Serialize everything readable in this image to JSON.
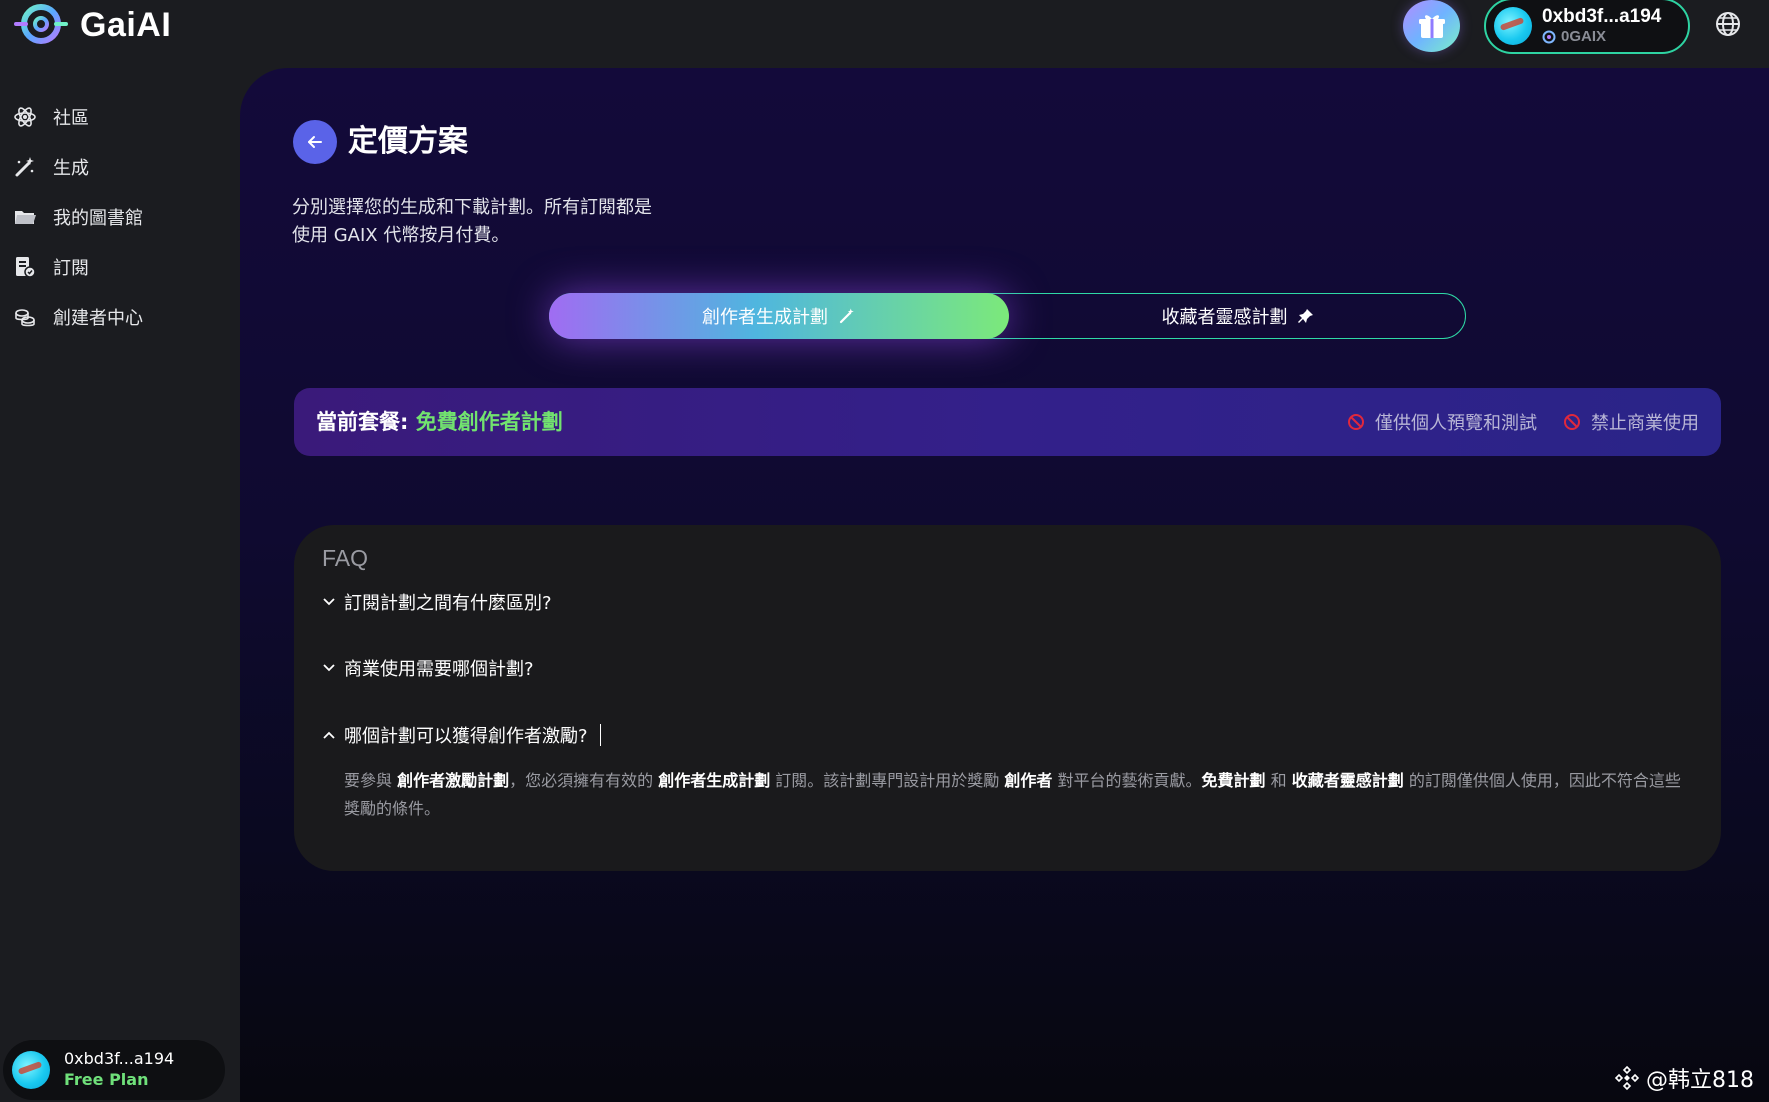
{
  "app": {
    "name": "GaiAI"
  },
  "header": {
    "wallet_address": "0xbd3f...a194",
    "wallet_token": "0GAIX"
  },
  "sidebar": {
    "items": [
      {
        "label": "社區",
        "icon": "atom-icon"
      },
      {
        "label": "生成",
        "icon": "magic-wand-icon"
      },
      {
        "label": "我的圖書館",
        "icon": "folder-icon"
      },
      {
        "label": "訂閱",
        "icon": "subscription-icon"
      },
      {
        "label": "創建者中心",
        "icon": "coins-icon"
      }
    ],
    "user": {
      "address": "0xbd3f...a194",
      "plan": "Free Plan"
    }
  },
  "main": {
    "title": "定價方案",
    "subtitle_line1": "分別選擇您的生成和下載計劃。所有訂閱都是",
    "subtitle_line2": "使用 GAIX 代幣按月付費。",
    "toggle": {
      "active_label": "創作者生成計劃",
      "inactive_label": "收藏者靈感計劃"
    },
    "current_plan": {
      "prefix": "當前套餐",
      "separator": ":",
      "name": "免費創作者計劃",
      "restrictions": [
        "僅供個人預覽和測試",
        "禁止商業使用"
      ]
    },
    "faq": {
      "title": "FAQ",
      "questions": [
        {
          "q": "訂閱計劃之間有什麼區別?",
          "expanded": false
        },
        {
          "q": "商業使用需要哪個計劃?",
          "expanded": false
        },
        {
          "q": "哪個計劃可以獲得創作者激勵?",
          "expanded": true
        }
      ],
      "answer": {
        "t1": "要參與 ",
        "b1": "創作者激勵計劃",
        "t2": "，您必須擁有有效的 ",
        "b2": "創作者生成計劃",
        "t3": " 訂閱。該計劃專門設計用於獎勵 ",
        "b3": "創作者",
        "t4": " 對平台的藝術貢獻。",
        "b4": "免費計劃",
        "t5": " 和 ",
        "b5": "收藏者靈感計劃",
        "t6": " 的訂閱僅供個人使用，因此不符合這些獎勵的條件。"
      }
    }
  },
  "watermark": {
    "text": "@韩立818"
  },
  "colors": {
    "accent_green": "#72e36f",
    "accent_teal": "#2fd9a6",
    "back_button": "#5a63e8",
    "restriction_red": "#e0283c"
  }
}
